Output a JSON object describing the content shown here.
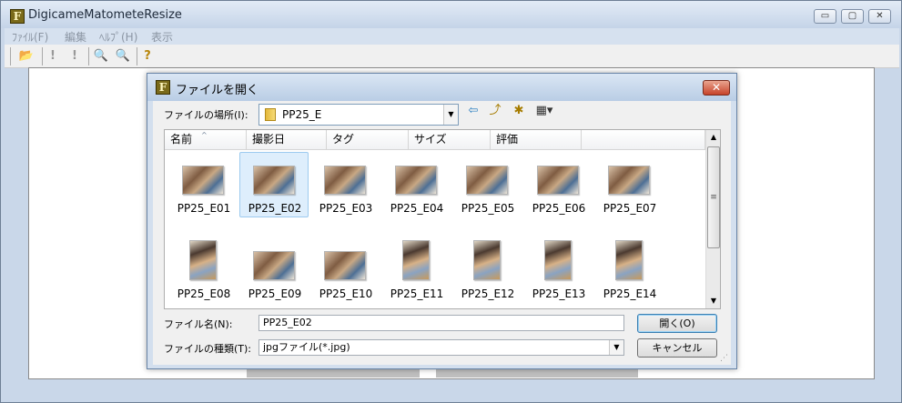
{
  "app": {
    "title": "DigicameMatometeResize",
    "icon_glyph": "F"
  },
  "window_controls": {
    "minimize": "▭",
    "maximize": "▢",
    "close": "✕"
  },
  "menu": [
    "ﾌｧｲﾙ(F)",
    "編集",
    "ﾍﾙﾌﾟ(H)",
    "表示"
  ],
  "toolbar": {
    "icons": [
      "open-folder-icon",
      "exclamation-icon",
      "exclamation-icon",
      "zoom-in-icon",
      "zoom-out-icon",
      "help-icon"
    ],
    "glyphs": {
      "open": "📂",
      "warn1": "!",
      "warn2": "!",
      "zoom_in": "🔍",
      "zoom_out": "🔍",
      "help": "?"
    }
  },
  "dialog": {
    "title": "ファイルを開く",
    "icon_glyph": "F",
    "close": "✕",
    "location_label": "ファイルの場所(I):",
    "location_value": "PP25_E",
    "nav_glyphs": {
      "back": "⇦",
      "up": "⤴",
      "new_folder": "✱",
      "view": "▦▾"
    },
    "columns": [
      "名前",
      "撮影日",
      "タグ",
      "サイズ",
      "評価"
    ],
    "sort_glyph": "^",
    "scroll": {
      "up": "▲",
      "down": "▼",
      "grip": "≡"
    },
    "files": [
      {
        "name": "PP25_E01",
        "orientation": "landscape"
      },
      {
        "name": "PP25_E02",
        "orientation": "landscape",
        "selected": true
      },
      {
        "name": "PP25_E03",
        "orientation": "landscape"
      },
      {
        "name": "PP25_E04",
        "orientation": "landscape"
      },
      {
        "name": "PP25_E05",
        "orientation": "landscape"
      },
      {
        "name": "PP25_E06",
        "orientation": "landscape"
      },
      {
        "name": "PP25_E07",
        "orientation": "landscape"
      },
      {
        "name": "PP25_E08",
        "orientation": "portrait"
      },
      {
        "name": "PP25_E09",
        "orientation": "landscape"
      },
      {
        "name": "PP25_E10",
        "orientation": "landscape"
      },
      {
        "name": "PP25_E11",
        "orientation": "portrait"
      },
      {
        "name": "PP25_E12",
        "orientation": "portrait"
      },
      {
        "name": "PP25_E13",
        "orientation": "portrait"
      },
      {
        "name": "PP25_E14",
        "orientation": "portrait"
      }
    ],
    "filename_label": "ファイル名(N):",
    "filename_value": "PP25_E02",
    "filetype_label": "ファイルの種類(T):",
    "filetype_value": "jpgファイル(*.jpg)",
    "open_button": "開く(O)",
    "cancel_button": "キャンセル",
    "grip_glyph": "⋰"
  }
}
